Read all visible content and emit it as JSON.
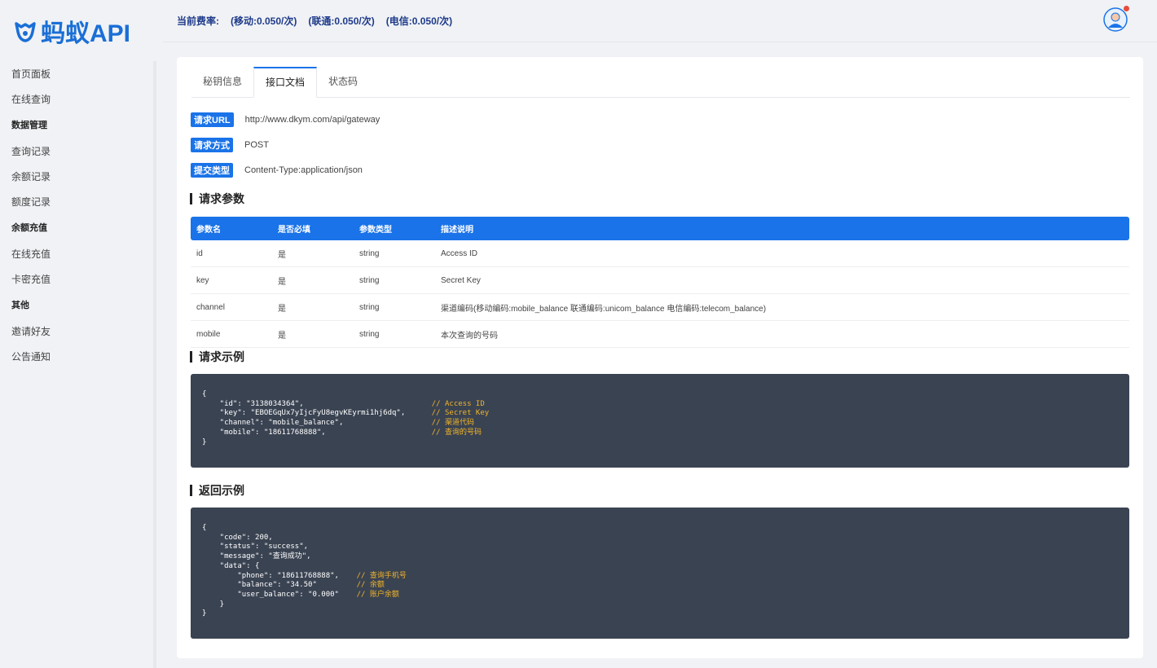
{
  "logo": {
    "text": "蚂蚁API"
  },
  "header": {
    "rate_label": "当前费率:",
    "rates": [
      "(移动:0.050/次)",
      "(联通:0.050/次)",
      "(电信:0.050/次)"
    ]
  },
  "sidebar": {
    "items": [
      {
        "type": "item",
        "label": "首页面板"
      },
      {
        "type": "item",
        "label": "在线查询"
      },
      {
        "type": "group",
        "label": "数据管理"
      },
      {
        "type": "item",
        "label": "查询记录"
      },
      {
        "type": "item",
        "label": "余额记录"
      },
      {
        "type": "item",
        "label": "额度记录"
      },
      {
        "type": "group",
        "label": "余额充值"
      },
      {
        "type": "item",
        "label": "在线充值"
      },
      {
        "type": "item",
        "label": "卡密充值"
      },
      {
        "type": "group",
        "label": "其他"
      },
      {
        "type": "item",
        "label": "邀请好友"
      },
      {
        "type": "item",
        "label": "公告通知"
      }
    ]
  },
  "tabs": [
    "秘钥信息",
    "接口文档",
    "状态码"
  ],
  "active_tab": 1,
  "request_info": [
    {
      "label": "请求URL",
      "value": "http://www.dkym.com/api/gateway"
    },
    {
      "label": "请求方式",
      "value": "POST"
    },
    {
      "label": "提交类型",
      "value": "Content-Type:application/json"
    }
  ],
  "sections": {
    "params": "请求参数",
    "request_example": "请求示例",
    "response_example": "返回示例"
  },
  "params_table": {
    "headers": [
      "参数名",
      "是否必填",
      "参数类型",
      "描述说明"
    ],
    "rows": [
      [
        "id",
        "是",
        "string",
        "Access ID"
      ],
      [
        "key",
        "是",
        "string",
        "Secret Key"
      ],
      [
        "channel",
        "是",
        "string",
        "渠道编码(移动编码:mobile_balance 联通编码:unicom_balance 电信编码:telecom_balance)"
      ],
      [
        "mobile",
        "是",
        "string",
        "本次查询的号码"
      ]
    ]
  },
  "request_example": [
    {
      "code": "{",
      "comment": ""
    },
    {
      "code": "    \"id\": \"3138034364\",",
      "comment": "// Access ID"
    },
    {
      "code": "    \"key\": \"EBOEGqUx7yIjcFyU8egvKEyrmi1hj6dq\",",
      "comment": "// Secret Key"
    },
    {
      "code": "    \"channel\": \"mobile_balance\",",
      "comment": "// 渠道代码"
    },
    {
      "code": "    \"mobile\": \"18611768888\",",
      "comment": "// 查询的号码"
    },
    {
      "code": "}",
      "comment": ""
    }
  ],
  "response_example": [
    {
      "code": "{",
      "comment": ""
    },
    {
      "code": "    \"code\": 200,",
      "comment": ""
    },
    {
      "code": "    \"status\": \"success\",",
      "comment": ""
    },
    {
      "code": "    \"message\": \"查询成功\",",
      "comment": ""
    },
    {
      "code": "    \"data\": {",
      "comment": ""
    },
    {
      "code": "        \"phone\": \"18611768888\",",
      "comment": "// 查询手机号"
    },
    {
      "code": "        \"balance\": \"34.50\"",
      "comment": "// 余额"
    },
    {
      "code": "        \"user_balance\": \"0.000\"",
      "comment": "// 账户余额"
    },
    {
      "code": "    }",
      "comment": ""
    },
    {
      "code": "}",
      "comment": ""
    }
  ]
}
